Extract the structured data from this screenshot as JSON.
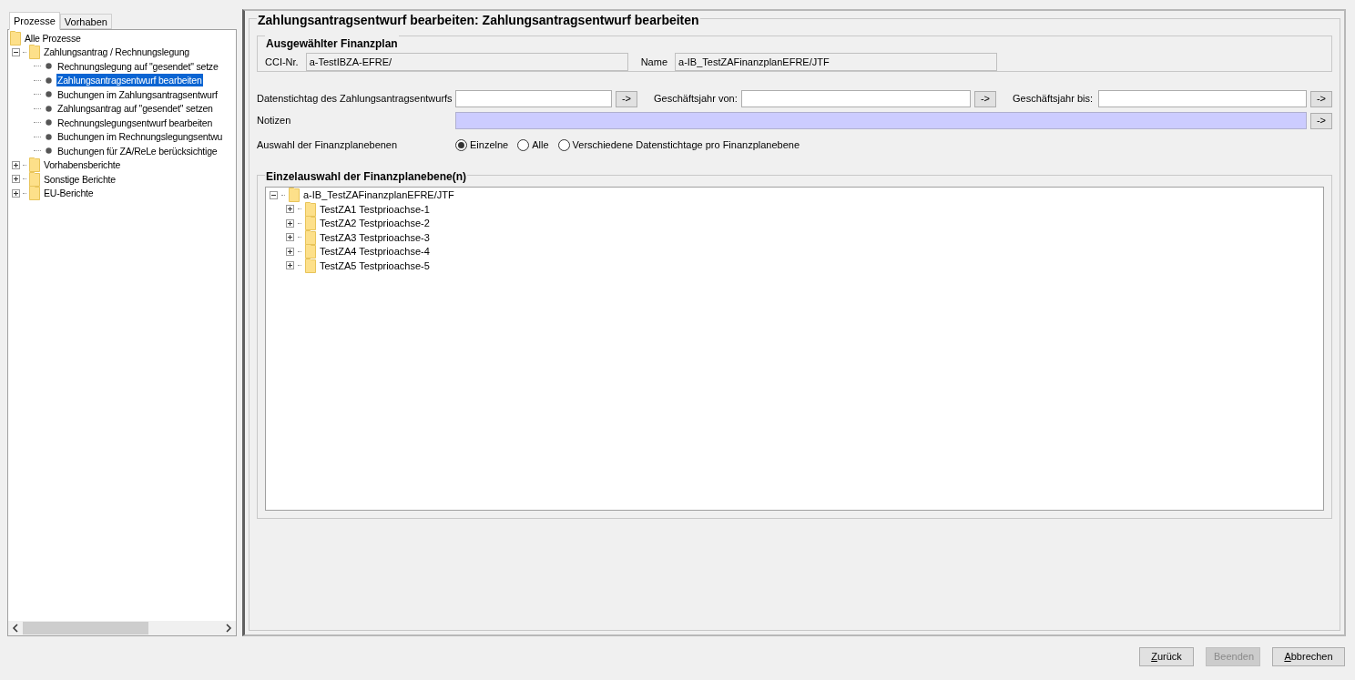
{
  "sidebar": {
    "tabs": [
      {
        "label": "Prozesse",
        "selected": true
      },
      {
        "label": "Vorhaben",
        "selected": false
      }
    ],
    "tree": [
      {
        "label": "Alle Prozesse",
        "kind": "folder",
        "selected": false,
        "children": [
          {
            "label": "Zahlungsantrag / Rechnungslegung",
            "kind": "folder",
            "expanded": true,
            "selected": false,
            "children": [
              {
                "label": "Rechnungslegung auf \"gesendet\" setze",
                "kind": "leaf",
                "selected": false
              },
              {
                "label": "Zahlungsantragsentwurf bearbeiten",
                "kind": "leaf",
                "selected": true
              },
              {
                "label": "Buchungen im Zahlungsantragsentwurf",
                "kind": "leaf",
                "selected": false
              },
              {
                "label": "Zahlungsantrag auf \"gesendet\" setzen",
                "kind": "leaf",
                "selected": false
              },
              {
                "label": "Rechnungslegungsentwurf bearbeiten",
                "kind": "leaf",
                "selected": false
              },
              {
                "label": "Buchungen im Rechnungslegungsentwu",
                "kind": "leaf",
                "selected": false
              },
              {
                "label": "Buchungen für ZA/ReLe berücksichtige",
                "kind": "leaf",
                "selected": false
              }
            ]
          },
          {
            "label": "Vorhabensberichte",
            "kind": "folder",
            "expanded": false,
            "selected": false
          },
          {
            "label": "Sonstige Berichte",
            "kind": "folder",
            "expanded": false,
            "selected": false
          },
          {
            "label": "EU-Berichte",
            "kind": "folder",
            "expanded": false,
            "selected": false
          }
        ]
      }
    ]
  },
  "main": {
    "title": "Zahlungsantragsentwurf bearbeiten: Zahlungsantragsentwurf bearbeiten",
    "finanzplan": {
      "legend": "Ausgewählter Finanzplan",
      "cci_label": "CCI-Nr.",
      "cci_value": "a-TestIBZA-EFRE/",
      "name_label": "Name",
      "name_value": "a-IB_TestZAFinanzplanEFRE/JTF"
    },
    "date_fields": [
      {
        "label": "Datenstichtag des Zahlungsantragsentwurfs",
        "button": "->"
      },
      {
        "label": "Geschäftsjahr von:",
        "button": "->"
      },
      {
        "label": "Geschäftsjahr bis:",
        "button": "->"
      }
    ],
    "notes": {
      "label": "Notizen",
      "button": "->"
    },
    "level_choice": {
      "label": "Auswahl der Finanzplanebenen",
      "options": [
        {
          "label": "Einzelne",
          "selected": true
        },
        {
          "label": "Alle",
          "selected": false
        },
        {
          "label": "Verschiedene Datenstichtage pro Finanzplanebene",
          "selected": false
        }
      ]
    },
    "levels": {
      "legend": "Einzelauswahl der Finanzplanebene(n)",
      "tree": [
        {
          "label": "a-IB_TestZAFinanzplanEFRE/JTF",
          "expanded": true,
          "children": [
            {
              "label": "TestZA1 Testprioachse-1",
              "expanded": false
            },
            {
              "label": "TestZA2 Testprioachse-2",
              "expanded": false
            },
            {
              "label": "TestZA3 Testprioachse-3",
              "expanded": false
            },
            {
              "label": "TestZA4 Testprioachse-4",
              "expanded": false
            },
            {
              "label": "TestZA5 Testprioachse-5",
              "expanded": false
            }
          ]
        }
      ]
    }
  },
  "buttons": [
    {
      "label": "Zurück",
      "disabled": false,
      "mnemonic": true
    },
    {
      "label": "Beenden",
      "disabled": true,
      "mnemonic": false
    },
    {
      "label": "Abbrechen",
      "disabled": false,
      "mnemonic": true
    }
  ]
}
